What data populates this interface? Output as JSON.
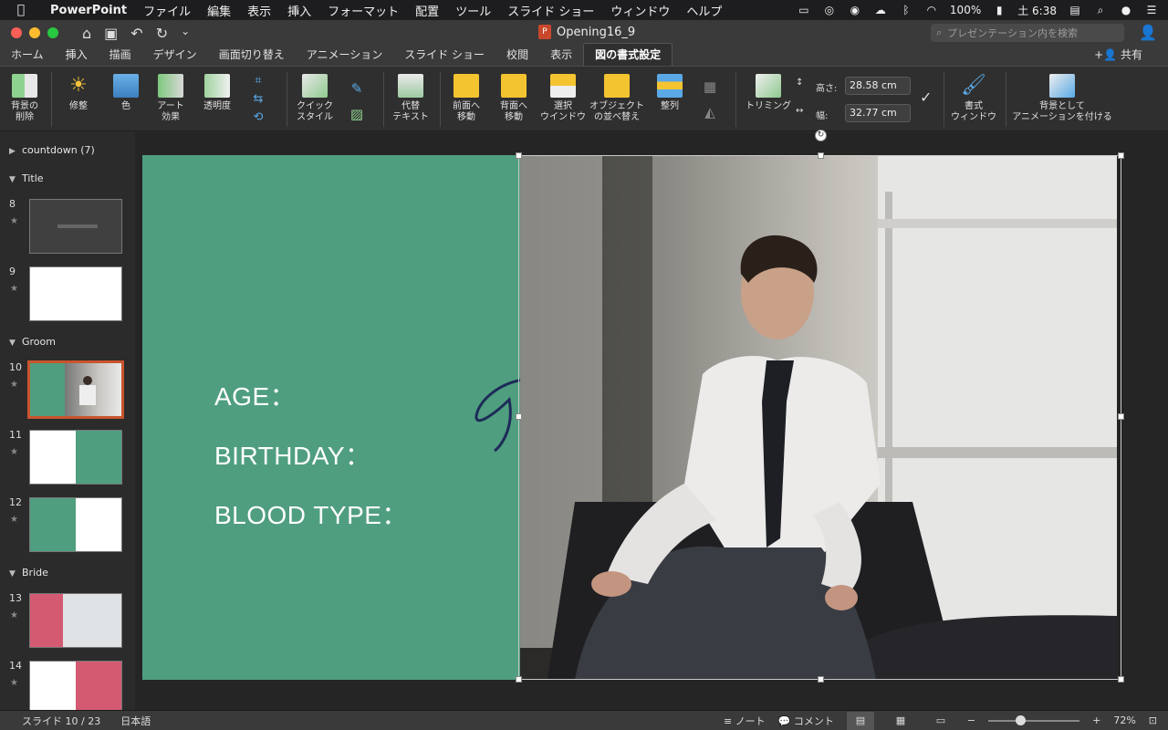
{
  "menubar": {
    "app": "PowerPoint",
    "items": [
      "ファイル",
      "編集",
      "表示",
      "挿入",
      "フォーマット",
      "配置",
      "ツール",
      "スライド ショー",
      "ウィンドウ",
      "ヘルプ"
    ],
    "battery": "100%",
    "clock": "土 6:38"
  },
  "titlebar": {
    "doc_title": "Opening16_9",
    "search_placeholder": "プレゼンテーション内を検索"
  },
  "ribbon_tabs": [
    "ホーム",
    "挿入",
    "描画",
    "デザイン",
    "画面切り替え",
    "アニメーション",
    "スライド ショー",
    "校閲",
    "表示",
    "図の書式設定"
  ],
  "active_tab": "図の書式設定",
  "share_label": "共有",
  "ribbon": {
    "remove_bg": [
      "背景の",
      "削除"
    ],
    "corrections": "修整",
    "color": "色",
    "art_effects": [
      "アート",
      "効果"
    ],
    "transparency": "透明度",
    "quick_styles": [
      "クイック",
      "スタイル"
    ],
    "alt_text": [
      "代替",
      "テキスト"
    ],
    "bring_forward": [
      "前面へ",
      "移動"
    ],
    "send_backward": [
      "背面へ",
      "移動"
    ],
    "selection_pane": [
      "選択",
      "ウインドウ"
    ],
    "reorder_objects": [
      "オブジェクト",
      "の並べ替え"
    ],
    "align": "整列",
    "crop": "トリミング",
    "height_label": "高さ:",
    "height_value": "28.58 cm",
    "width_label": "幅:",
    "width_value": "32.77 cm",
    "format_pane": [
      "書式",
      "ウィンドウ"
    ],
    "animate_bg": [
      "背景として",
      "アニメーションを付ける"
    ]
  },
  "slides_pane": {
    "sections": [
      {
        "name": "countdown (7)"
      },
      {
        "name": "Title"
      },
      {
        "name": "Groom"
      },
      {
        "name": "Bride"
      }
    ],
    "slide_numbers": [
      "8",
      "9",
      "10",
      "11",
      "12",
      "13",
      "14"
    ],
    "selected": "10"
  },
  "slide": {
    "lines": [
      "AGE：",
      "BIRTHDAY：",
      "BLOOD TYPE："
    ],
    "panel_color": "#4f9e7f"
  },
  "status": {
    "slide_info": "スライド 10 / 23",
    "language": "日本語",
    "notes": "ノート",
    "comments": "コメント",
    "zoom": "72%"
  },
  "colors": {
    "accent_tab": "#ffffff",
    "selection_border": "#c8552e",
    "groom_green": "#4f9e7f",
    "bride_pink": "#d45a72"
  }
}
